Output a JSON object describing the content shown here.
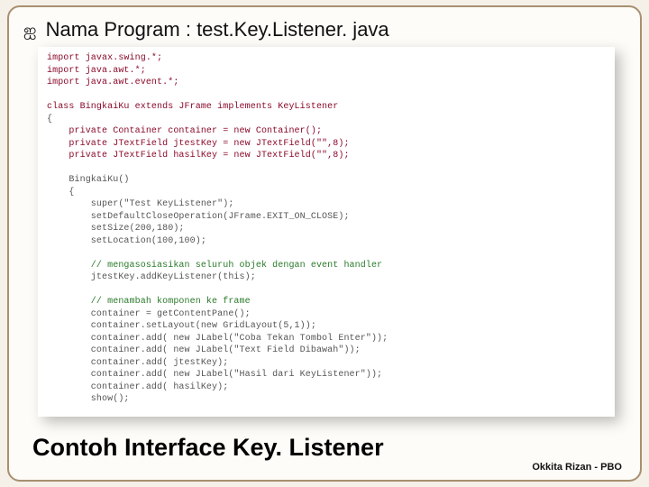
{
  "header": {
    "bullet": "ಠ",
    "text": "Nama Program : test.Key.Listener. java"
  },
  "code": {
    "lines": [
      {
        "cls": "kw",
        "t": "import javax.swing.*;"
      },
      {
        "cls": "kw",
        "t": "import java.awt.*;"
      },
      {
        "cls": "kw",
        "t": "import java.awt.event.*;"
      },
      {
        "cls": "",
        "t": ""
      },
      {
        "cls": "kw",
        "t": "class BingkaiKu extends JFrame implements KeyListener"
      },
      {
        "cls": "",
        "t": "{"
      },
      {
        "cls": "kw",
        "t": "    private Container container = new Container();"
      },
      {
        "cls": "kw",
        "t": "    private JTextField jtestKey = new JTextField(\"\",8);"
      },
      {
        "cls": "kw",
        "t": "    private JTextField hasilKey = new JTextField(\"\",8);"
      },
      {
        "cls": "",
        "t": ""
      },
      {
        "cls": "",
        "t": "    BingkaiKu()"
      },
      {
        "cls": "",
        "t": "    {"
      },
      {
        "cls": "",
        "t": "        super(\"Test KeyListener\");"
      },
      {
        "cls": "",
        "t": "        setDefaultCloseOperation(JFrame.EXIT_ON_CLOSE);"
      },
      {
        "cls": "",
        "t": "        setSize(200,180);"
      },
      {
        "cls": "",
        "t": "        setLocation(100,100);"
      },
      {
        "cls": "",
        "t": ""
      },
      {
        "cls": "cmt",
        "t": "        // mengasosiasikan seluruh objek dengan event handler"
      },
      {
        "cls": "",
        "t": "        jtestKey.addKeyListener(this);"
      },
      {
        "cls": "",
        "t": ""
      },
      {
        "cls": "cmt",
        "t": "        // menambah komponen ke frame"
      },
      {
        "cls": "",
        "t": "        container = getContentPane();"
      },
      {
        "cls": "",
        "t": "        container.setLayout(new GridLayout(5,1));"
      },
      {
        "cls": "",
        "t": "        container.add( new JLabel(\"Coba Tekan Tombol Enter\"));"
      },
      {
        "cls": "",
        "t": "        container.add( new JLabel(\"Text Field Dibawah\"));"
      },
      {
        "cls": "",
        "t": "        container.add( jtestKey);"
      },
      {
        "cls": "",
        "t": "        container.add( new JLabel(\"Hasil dari KeyListener\"));"
      },
      {
        "cls": "",
        "t": "        container.add( hasilKey);"
      },
      {
        "cls": "",
        "t": "        show();"
      }
    ]
  },
  "footer": {
    "title": "Contoh Interface Key. Listener",
    "author": "Okkita Rizan - PBO"
  }
}
